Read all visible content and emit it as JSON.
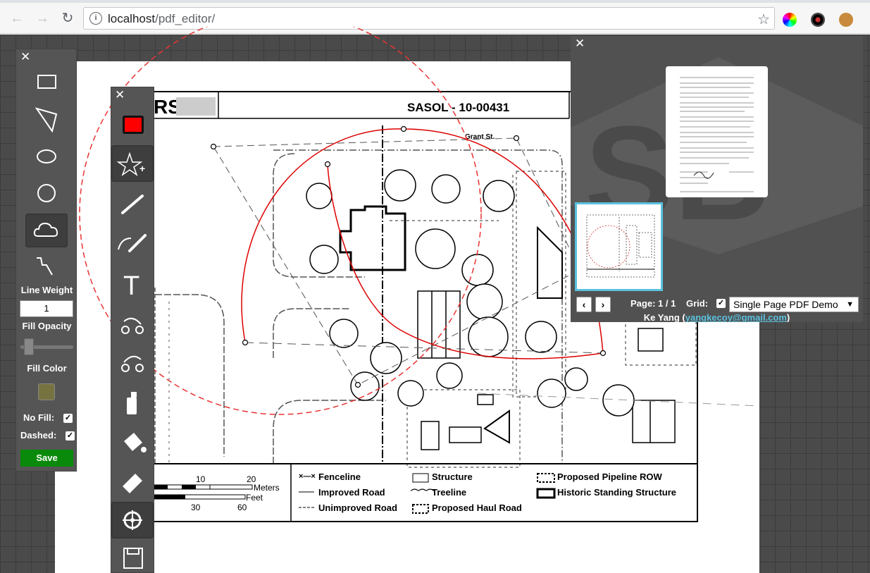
{
  "browser": {
    "url_host": "localhost",
    "url_path": "/pdf_editor/"
  },
  "shape_panel": {
    "tools": [
      "rectangle",
      "triangle",
      "ellipse",
      "circle",
      "cloud",
      "polyline"
    ],
    "active_tool": "cloud",
    "line_weight_label": "Line Weight",
    "line_weight_value": "1",
    "fill_opacity_label": "Fill Opacity",
    "fill_opacity": 0.15,
    "fill_color_label": "Fill Color",
    "fill_color": "#767341",
    "no_fill_label": "No Fill:",
    "dashed_label": "Dashed:",
    "save_label": "Save"
  },
  "tool_panel": {
    "color": "#ff0000",
    "active_tool": "shapes"
  },
  "pdf": {
    "title": "SASOL - 10-00431",
    "street": "Grant St.",
    "logo_text": "RS",
    "scale_meters": [
      "10",
      "20"
    ],
    "scale_feet": [
      "30",
      "60"
    ],
    "meters_label": "Meters",
    "feet_label": "Feet",
    "legend": [
      "Fenceline",
      "Improved Road",
      "Unimproved Road",
      "Structure",
      "Treeline",
      "Proposed Haul Road",
      "Proposed Pipeline ROW",
      "Historic Standing Structure"
    ]
  },
  "pages_panel": {
    "page_label": "Page: 1 / 1",
    "grid_label": "Grid:",
    "doc_select": "Single Page PDF Demo",
    "author": "Ke Yang",
    "email": "yangkecoy@gmail.com",
    "prev": "‹",
    "next": "›"
  },
  "accent_colors": {
    "annotation": "#dd0000",
    "save": "#0a8a0a",
    "link": "#5bc0de"
  }
}
